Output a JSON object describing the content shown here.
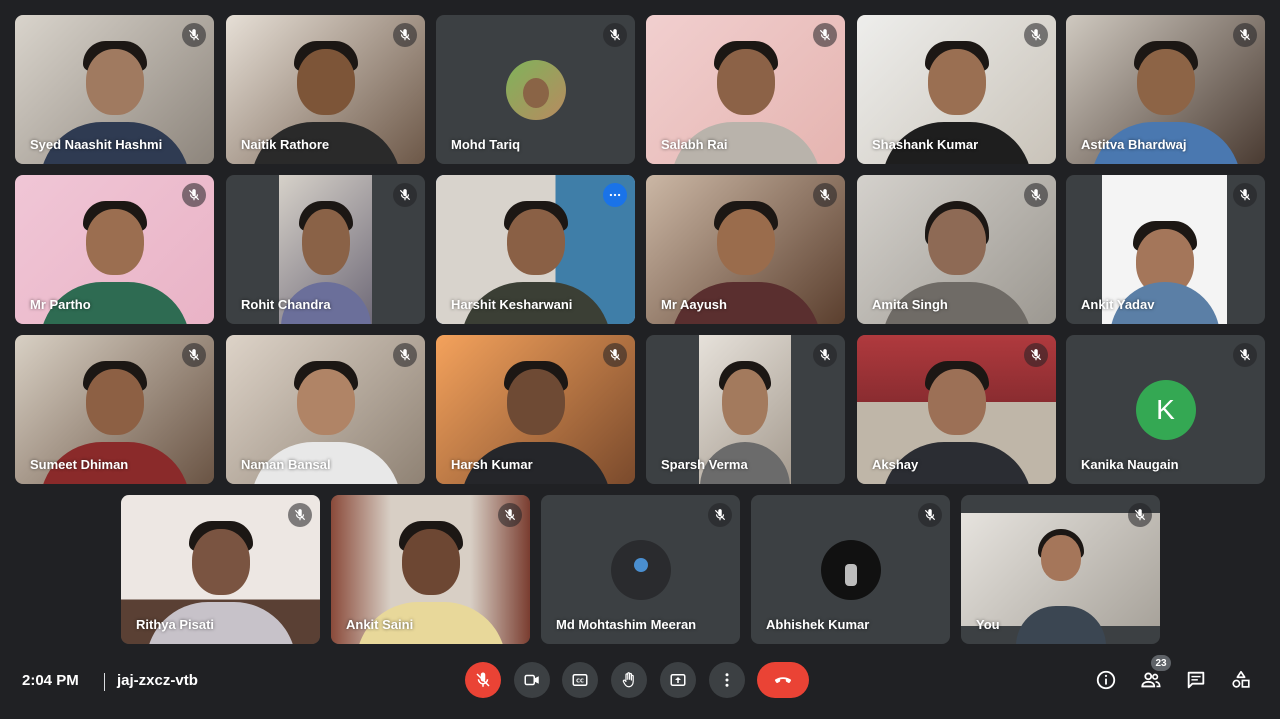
{
  "participants": [
    {
      "name": "Syed Naashit Hashmi",
      "muted": true
    },
    {
      "name": "Naitik Rathore",
      "muted": true
    },
    {
      "name": "Mohd Tariq",
      "muted": true
    },
    {
      "name": "Salabh Rai",
      "muted": true
    },
    {
      "name": "Shashank Kumar",
      "muted": true
    },
    {
      "name": "Astitva Bhardwaj",
      "muted": true
    },
    {
      "name": "Mr Partho",
      "muted": true
    },
    {
      "name": "Rohit Chandra",
      "muted": true
    },
    {
      "name": "Harshit Kesharwani",
      "muted": false,
      "speaking": true
    },
    {
      "name": "Mr Aayush",
      "muted": true
    },
    {
      "name": "Amita Singh",
      "muted": true
    },
    {
      "name": "Ankit Yadav",
      "muted": true
    },
    {
      "name": "Sumeet Dhiman",
      "muted": true
    },
    {
      "name": "Naman Bansal",
      "muted": true
    },
    {
      "name": "Harsh Kumar",
      "muted": true
    },
    {
      "name": "Sparsh Verma",
      "muted": true
    },
    {
      "name": "Akshay",
      "muted": true
    },
    {
      "name": "Kanika Naugain",
      "muted": true,
      "avatar_letter": "K",
      "avatar_color": "#34a853"
    },
    {
      "name": "Rithya Pisati",
      "muted": true
    },
    {
      "name": "Ankit Saini",
      "muted": true
    },
    {
      "name": "Md Mohtashim Meeran",
      "muted": true
    },
    {
      "name": "Abhishek Kumar",
      "muted": true
    },
    {
      "name": "You",
      "muted": true
    }
  ],
  "bottom_bar": {
    "time": "2:04 PM",
    "separator": "|",
    "meeting_code": "jaj-zxcz-vtb",
    "participant_count": "23"
  },
  "colors": {
    "background": "#202124",
    "tile": "#3c4043",
    "active_outline": "#8ab4f8",
    "danger": "#ea4335",
    "accent_blue": "#1a73e8"
  },
  "icons": {
    "tile_mic": "mic-off-icon",
    "controls": [
      "mic-off-icon",
      "camera-icon",
      "captions-icon",
      "raise-hand-icon",
      "present-icon",
      "more-options-icon",
      "hang-up-icon"
    ],
    "side": [
      "info-icon",
      "people-icon",
      "chat-icon",
      "activities-icon"
    ]
  }
}
